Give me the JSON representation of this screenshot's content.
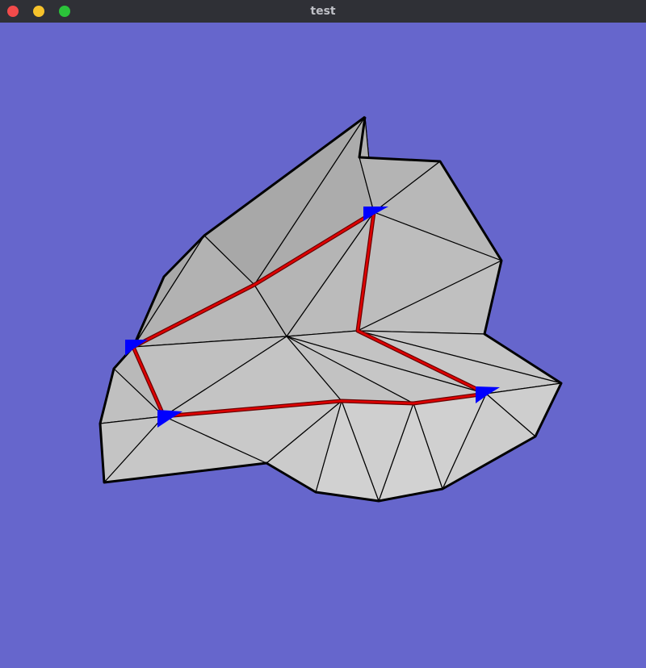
{
  "window": {
    "title": "test"
  },
  "colors": {
    "background": "#6666cc",
    "titlebar": "#2f3036",
    "mesh_face": "#bdbdbd",
    "mesh_edge": "#000000",
    "path": "#d40000",
    "marker": "#0000ff"
  },
  "icons": [
    "close-icon",
    "minimize-icon",
    "maximize-icon"
  ]
}
